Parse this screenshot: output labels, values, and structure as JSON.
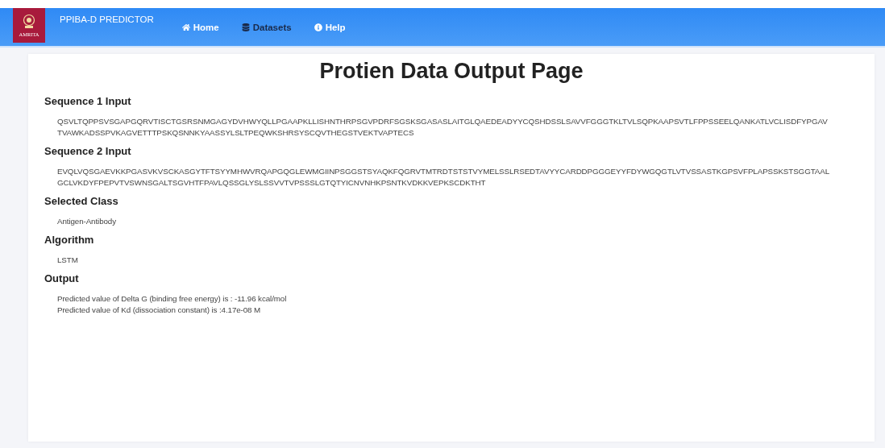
{
  "navbar": {
    "brand": "PPIBA-D PREDICTOR",
    "logo_text": "AMRITA",
    "links": [
      {
        "label": "Home",
        "kind": "home"
      },
      {
        "label": "Datasets",
        "kind": "data"
      },
      {
        "label": "Help",
        "kind": "help"
      }
    ]
  },
  "title": "Protien Data Output Page",
  "sections": [
    {
      "heading": "Sequence 1 Input",
      "lines": [
        "QSVLTQPPSVSGAPGQRVTISCTGSRSNMGAGYDVHWYQLLPGAAPKLLISHNTHRPSGVPDRFSGSKSGASASLAITGLQAEDEADYYCQSHDSSLSAVVFGGGTKLTVLSQPKAAPSVTLFPPSSEELQANKATLVCLISDFYPGAV",
        "TVAWKADSSPVKAGVETTTPSKQSNNKYAASSYLSLTPEQWKSHRSYSCQVTHEGSTVEKTVAPTECS"
      ]
    },
    {
      "heading": "Sequence 2 Input",
      "lines": [
        "EVQLVQSGAEVKKPGASVKVSCKASGYTFTSYYMHWVRQAPGQGLEWMGIINPSGGSTSYAQKFQGRVTMTRDTSTSTVYMELSSLRSEDTAVYYCARDDPGGGEYYFDYWGQGTLVTVSSASTKGPSVFPLAPSSKSTSGGTAAL",
        "GCLVKDYFPEPVTVSWNSGALTSGVHTFPAVLQSSGLYSLSSVVTVPSSSLGTQTYICNVNHKPSNTKVDKKVEPKSCDKTHT"
      ]
    },
    {
      "heading": "Selected Class",
      "lines": [
        "Antigen-Antibody"
      ]
    },
    {
      "heading": "Algorithm",
      "lines": [
        "LSTM"
      ]
    },
    {
      "heading": "Output",
      "lines": [
        "Predicted value of Delta G (binding free energy) is : -11.96 kcal/mol",
        "Predicted value of Kd (dissociation constant) is :4.17e-08 M"
      ]
    }
  ]
}
